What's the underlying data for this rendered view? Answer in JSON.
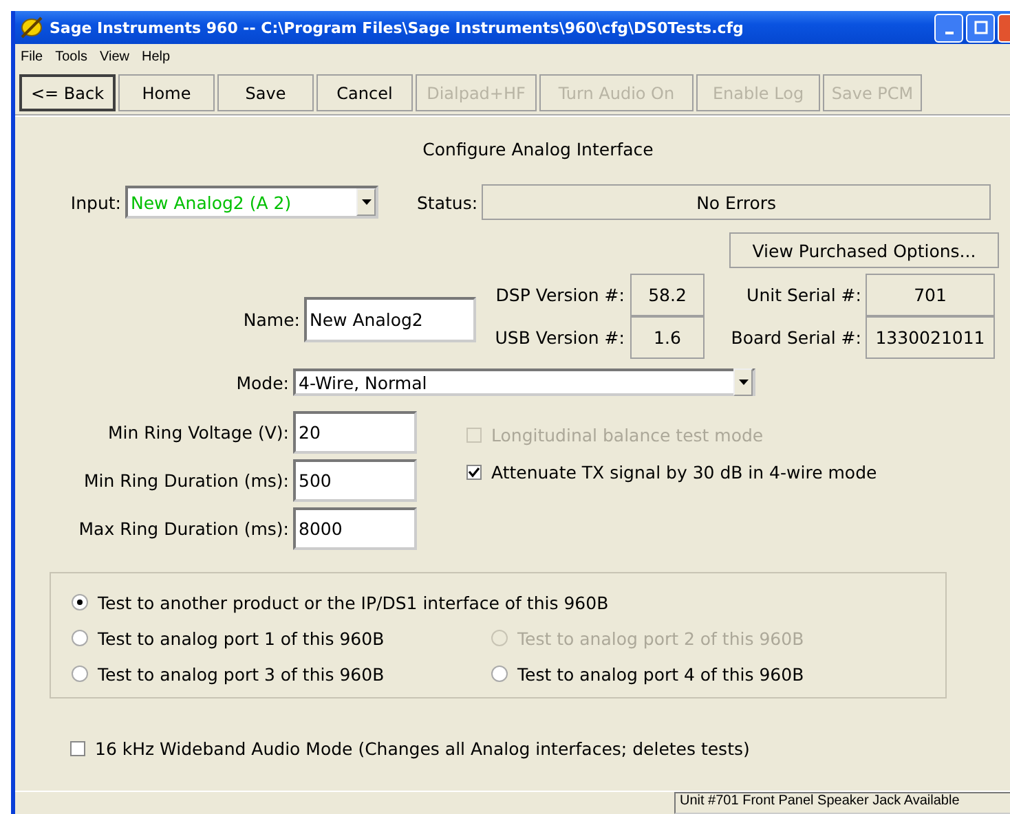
{
  "window": {
    "title": "Sage Instruments 960 -- C:\\Program Files\\Sage Instruments\\960\\cfg\\DS0Tests.cfg"
  },
  "menu": [
    "File",
    "Tools",
    "View",
    "Help"
  ],
  "toolbar": [
    {
      "label": "<= Back",
      "disabled": false,
      "selected": true
    },
    {
      "label": "Home",
      "disabled": false,
      "selected": false
    },
    {
      "label": "Save",
      "disabled": false,
      "selected": false
    },
    {
      "label": "Cancel",
      "disabled": false,
      "selected": false
    },
    {
      "label": "Dialpad+HF",
      "disabled": true,
      "selected": false
    },
    {
      "label": "Turn Audio On",
      "disabled": true,
      "selected": false
    },
    {
      "label": "Enable Log",
      "disabled": true,
      "selected": false
    },
    {
      "label": "Save PCM",
      "disabled": true,
      "selected": false
    }
  ],
  "heading": "Configure Analog Interface",
  "input": {
    "label": "Input:",
    "value": "New Analog2 (A 2)",
    "color": "#00c000"
  },
  "status": {
    "label": "Status:",
    "value": "No Errors"
  },
  "purchased_button": "View Purchased Options...",
  "name": {
    "label": "Name:",
    "value": "New Analog2"
  },
  "versions": [
    {
      "label": "DSP Version #:",
      "value": "58.2"
    },
    {
      "label": "USB Version #:",
      "value": "1.6"
    }
  ],
  "serials": [
    {
      "label": "Unit Serial #:",
      "value": "701"
    },
    {
      "label": "Board Serial #:",
      "value": "1330021011"
    }
  ],
  "mode": {
    "label": "Mode:",
    "value": "4-Wire, Normal"
  },
  "ring_fields": [
    {
      "label": "Min Ring Voltage (V):",
      "value": "20"
    },
    {
      "label": "Min Ring Duration (ms):",
      "value": "500"
    },
    {
      "label": "Max Ring Duration (ms):",
      "value": "8000"
    }
  ],
  "options": [
    {
      "label": "Longitudinal balance test mode",
      "checked": false,
      "disabled": true
    },
    {
      "label": "Attenuate TX signal by 30 dB in 4-wire mode",
      "checked": true,
      "disabled": false
    }
  ],
  "test_targets": [
    {
      "label": "Test to another product or the IP/DS1 interface of this 960B",
      "selected": true,
      "disabled": false
    },
    {
      "label": "Test to analog port 1 of this 960B",
      "selected": false,
      "disabled": false
    },
    {
      "label": "Test to analog port 2 of this 960B",
      "selected": false,
      "disabled": true
    },
    {
      "label": "Test to analog port 3 of this 960B",
      "selected": false,
      "disabled": false
    },
    {
      "label": "Test to analog port 4 of this 960B",
      "selected": false,
      "disabled": false
    }
  ],
  "wideband": {
    "label": "16 kHz Wideband Audio Mode (Changes all Analog interfaces; deletes tests)",
    "checked": false
  },
  "status_bar": "Unit #701 Front Panel Speaker Jack Available"
}
